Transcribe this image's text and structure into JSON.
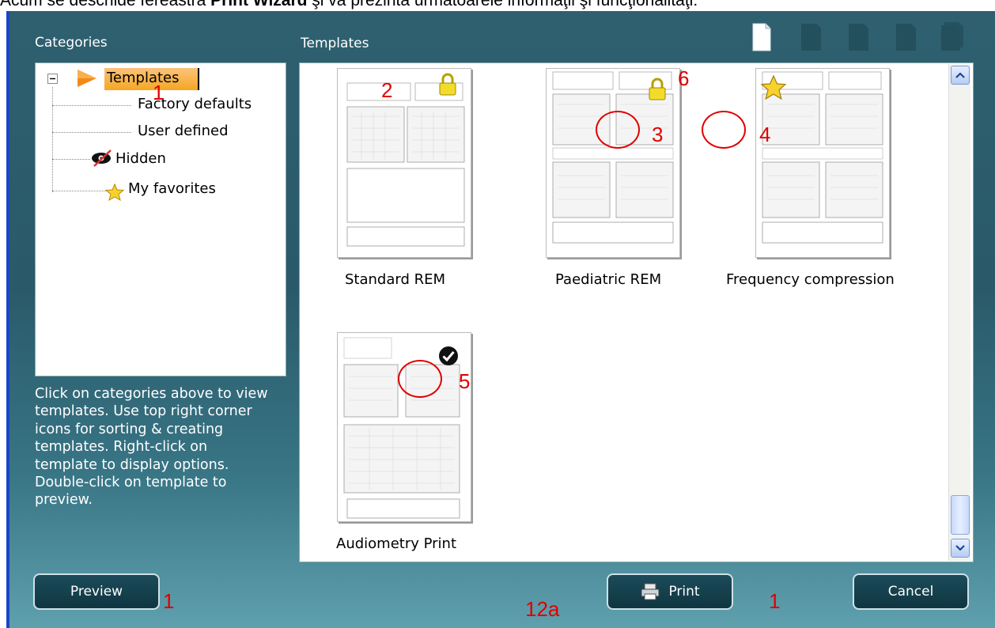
{
  "document": {
    "caption_prefix": "Acum se deschide fereastra ",
    "caption_bold": "Print Wizard",
    "caption_suffix": " şi va prezinta urmatoarele informaţii şi funcţionalitaţi:"
  },
  "sidebar": {
    "title": "Categories",
    "tree": {
      "root_label": "Templates",
      "items": [
        {
          "label": "Factory defaults",
          "icon": "none"
        },
        {
          "label": "User defined",
          "icon": "none"
        },
        {
          "label": "Hidden",
          "icon": "hidden-eye-icon"
        },
        {
          "label": "My favorites",
          "icon": "star-icon"
        }
      ]
    },
    "help_text": "Click on categories above to view templates. Use top right corner icons for sorting & creating templates. Right-click on template to display options. Double-click on template to preview."
  },
  "main": {
    "title": "Templates",
    "templates": [
      {
        "label": "Standard REM",
        "badge": "lock-icon"
      },
      {
        "label": "Paediatric REM",
        "badge": "lock-icon"
      },
      {
        "label": "Frequency compression",
        "badge": "star-icon"
      },
      {
        "label": "Audiometry Print",
        "badge": "checkmark-icon"
      }
    ]
  },
  "footer": {
    "preview": "Preview",
    "print": "Print",
    "cancel": "Cancel"
  },
  "annotations": [
    "1",
    "2",
    "3",
    "4",
    "5",
    "6",
    "1",
    "12a",
    "1"
  ],
  "colors": {
    "window_bg": "#2e6070",
    "accent_blue": "#1846c8",
    "annotation_red": "#e00000",
    "selected_item_bg": "#f5a623"
  }
}
